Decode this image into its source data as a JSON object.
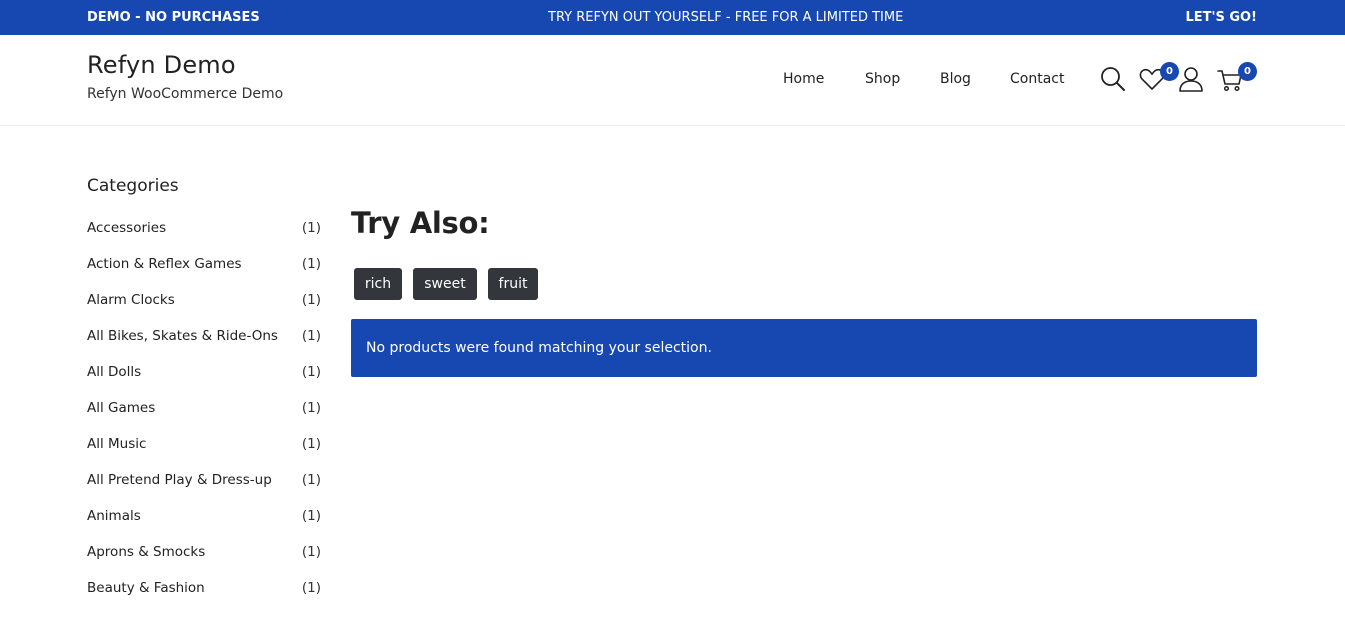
{
  "topbar": {
    "left": "DEMO - NO PURCHASES",
    "center": "TRY REFYN OUT YOURSELF - FREE FOR A LIMITED TIME",
    "right": "LET'S GO!"
  },
  "header": {
    "site_title": "Refyn Demo",
    "tagline": "Refyn WooCommerce Demo",
    "nav": [
      "Home",
      "Shop",
      "Blog",
      "Contact"
    ],
    "wishlist_count": "0",
    "cart_count": "0",
    "icons": [
      "search-icon",
      "heart-icon",
      "user-icon",
      "cart-icon"
    ]
  },
  "sidebar": {
    "heading": "Categories",
    "categories": [
      {
        "name": "Accessories",
        "count": "(1)"
      },
      {
        "name": "Action & Reflex Games",
        "count": "(1)"
      },
      {
        "name": "Alarm Clocks",
        "count": "(1)"
      },
      {
        "name": "All Bikes, Skates & Ride-Ons",
        "count": "(1)"
      },
      {
        "name": "All Dolls",
        "count": "(1)"
      },
      {
        "name": "All Games",
        "count": "(1)"
      },
      {
        "name": "All Music",
        "count": "(1)"
      },
      {
        "name": "All Pretend Play & Dress-up",
        "count": "(1)"
      },
      {
        "name": "Animals",
        "count": "(1)"
      },
      {
        "name": "Aprons & Smocks",
        "count": "(1)"
      },
      {
        "name": "Beauty & Fashion",
        "count": "(1)"
      }
    ]
  },
  "main": {
    "heading": "Try Also:",
    "tags": [
      "rich",
      "sweet",
      "fruit"
    ],
    "notice": "No products were found matching your selection."
  },
  "colors": {
    "accent": "#1747b0",
    "tag_bg": "#33373b"
  }
}
